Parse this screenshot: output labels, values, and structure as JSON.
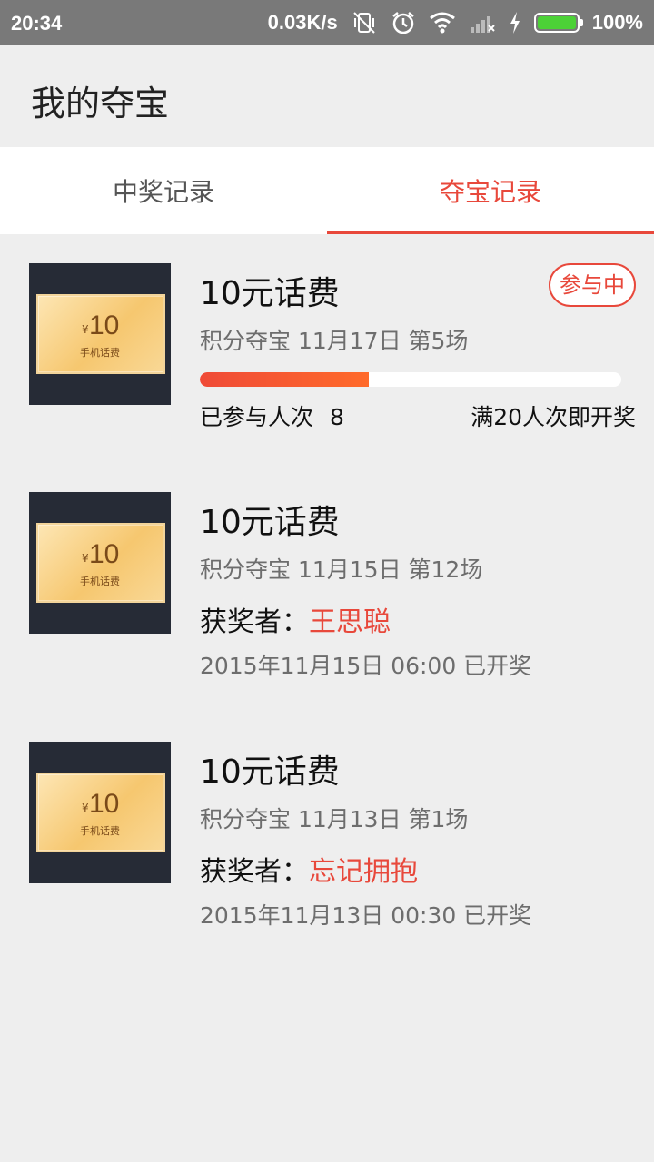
{
  "status_bar": {
    "time": "20:34",
    "net_speed": "0.03K/s",
    "battery": "100%",
    "icons": [
      "vibrate-off-icon",
      "alarm-icon",
      "wifi-icon",
      "signal-icon",
      "charging-icon",
      "battery-icon"
    ]
  },
  "app_bar": {
    "title": "我的夺宝"
  },
  "tabs": [
    {
      "label": "中奖记录",
      "active": false
    },
    {
      "label": "夺宝记录",
      "active": true
    }
  ],
  "items": [
    {
      "thumb": {
        "yen": "¥",
        "amount": "10",
        "label": "手机话费"
      },
      "title": "10元话费",
      "meta": "积分夺宝 11月17日 第5场",
      "status": "参与中",
      "progress": 0.4,
      "joined_label": "已参与人次",
      "joined_count": "8",
      "threshold": "满20人次即开奖"
    },
    {
      "thumb": {
        "yen": "¥",
        "amount": "10",
        "label": "手机话费"
      },
      "title": "10元话费",
      "meta": "积分夺宝 11月15日 第12场",
      "winner_label": "获奖者：",
      "winner": "王思聪",
      "date": "2015年11月15日 06:00 已开奖"
    },
    {
      "thumb": {
        "yen": "¥",
        "amount": "10",
        "label": "手机话费"
      },
      "title": "10元话费",
      "meta": "积分夺宝 11月13日 第1场",
      "winner_label": "获奖者：",
      "winner": "忘记拥抱",
      "date": "2015年11月13日 00:30 已开奖"
    }
  ],
  "colors": {
    "accent": "#e8483b",
    "status_bar": "#797979",
    "background": "#eeeeee"
  }
}
